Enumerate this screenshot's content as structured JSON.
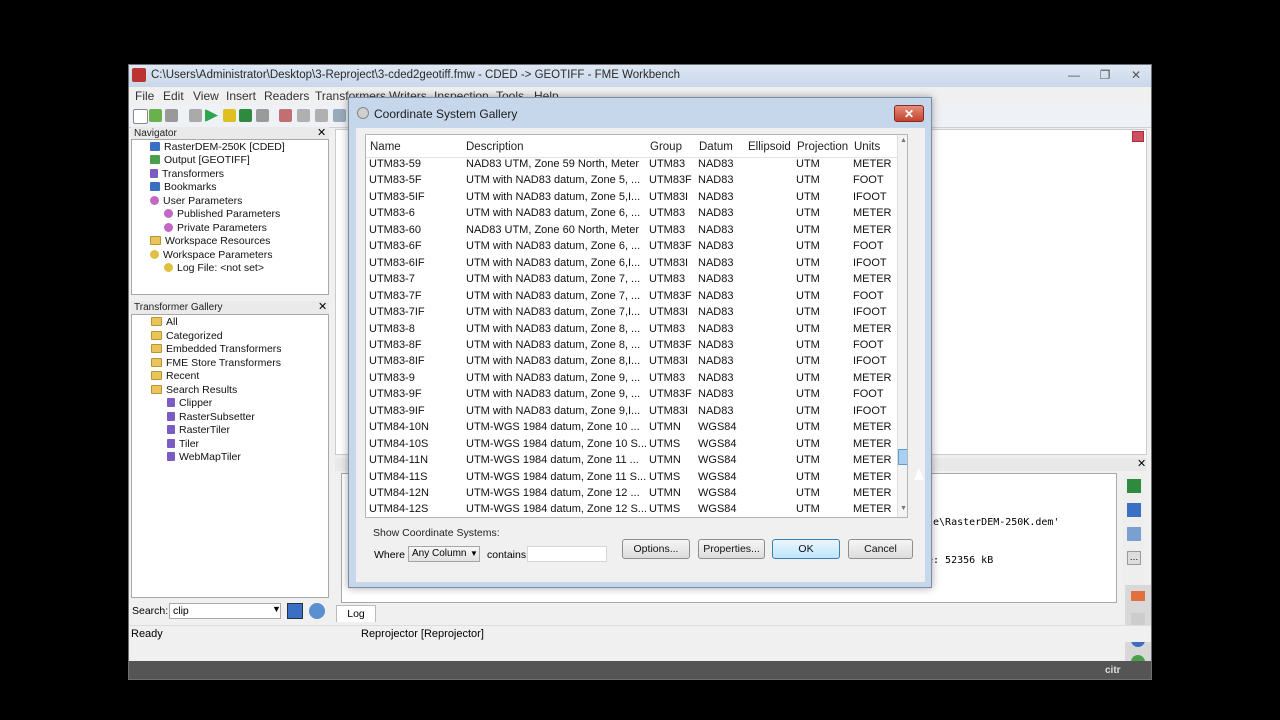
{
  "window": {
    "title": "C:\\Users\\Administrator\\Desktop\\3-Reproject\\3-cded2geotiff.fmw - CDED -> GEOTIFF - FME Workbench",
    "menu": [
      "File",
      "Edit",
      "View",
      "Insert",
      "Readers",
      "Transformers",
      "Writers",
      "Inspection",
      "Tools",
      "Help"
    ]
  },
  "navigator": {
    "title": "Navigator",
    "items": [
      {
        "label": "RasterDEM-250K [CDED]",
        "icon": "reader-icon"
      },
      {
        "label": "Output [GEOTIFF]",
        "icon": "writer-icon"
      },
      {
        "label": "Transformers",
        "icon": "transformer-icon"
      },
      {
        "label": "Bookmarks",
        "icon": "bookmark-icon"
      },
      {
        "label": "User Parameters",
        "icon": "gear-icon"
      },
      {
        "label": "Published Parameters",
        "icon": "gear-icon"
      },
      {
        "label": "Private Parameters",
        "icon": "gear-icon"
      },
      {
        "label": "Workspace Resources",
        "icon": "folder-icon"
      },
      {
        "label": "Workspace Parameters",
        "icon": "gear-icon"
      },
      {
        "label": "Log File: <not set>",
        "icon": "gear-icon"
      }
    ]
  },
  "transformer_gallery": {
    "title": "Transformer Gallery",
    "items": [
      {
        "label": "All",
        "icon": "folder-icon"
      },
      {
        "label": "Categorized",
        "icon": "folder-icon"
      },
      {
        "label": "Embedded Transformers",
        "icon": "folder-icon"
      },
      {
        "label": "FME Store Transformers",
        "icon": "folder-icon"
      },
      {
        "label": "Recent",
        "icon": "folder-icon"
      },
      {
        "label": "Search Results",
        "icon": "folder-icon"
      },
      {
        "label": "Clipper",
        "icon": "transformer-icon"
      },
      {
        "label": "RasterSubsetter",
        "icon": "transformer-icon"
      },
      {
        "label": "RasterTiler",
        "icon": "transformer-icon"
      },
      {
        "label": "Tiler",
        "icon": "transformer-icon"
      },
      {
        "label": "WebMapTiler",
        "icon": "transformer-icon"
      }
    ],
    "search_label": "Search:",
    "search_value": "clip"
  },
  "log": {
    "tab_label": "Log",
    "line1": "le\\RasterDEM-250K.dem'",
    "line2": "e: 52356 kB"
  },
  "statusbar": {
    "left": "Ready",
    "middle": "Reprojector [Reprojector]"
  },
  "dialog": {
    "title": "Coordinate System Gallery",
    "columns": [
      "Name",
      "Description",
      "Group",
      "Datum",
      "Ellipsoid",
      "Projection",
      "Units"
    ],
    "rows": [
      [
        "UTM83-59",
        "NAD83 UTM, Zone 59 North, Meter",
        "UTM83",
        "NAD83",
        "",
        "UTM",
        "METER"
      ],
      [
        "UTM83-5F",
        "UTM with NAD83 datum, Zone 5, ...",
        "UTM83F",
        "NAD83",
        "",
        "UTM",
        "FOOT"
      ],
      [
        "UTM83-5IF",
        "UTM with NAD83 datum, Zone 5,I...",
        "UTM83I",
        "NAD83",
        "",
        "UTM",
        "IFOOT"
      ],
      [
        "UTM83-6",
        "UTM with NAD83 datum, Zone 6, ...",
        "UTM83",
        "NAD83",
        "",
        "UTM",
        "METER"
      ],
      [
        "UTM83-60",
        "NAD83 UTM, Zone 60 North, Meter",
        "UTM83",
        "NAD83",
        "",
        "UTM",
        "METER"
      ],
      [
        "UTM83-6F",
        "UTM with NAD83 datum, Zone 6, ...",
        "UTM83F",
        "NAD83",
        "",
        "UTM",
        "FOOT"
      ],
      [
        "UTM83-6IF",
        "UTM with NAD83 datum, Zone 6,I...",
        "UTM83I",
        "NAD83",
        "",
        "UTM",
        "IFOOT"
      ],
      [
        "UTM83-7",
        "UTM with NAD83 datum, Zone 7, ...",
        "UTM83",
        "NAD83",
        "",
        "UTM",
        "METER"
      ],
      [
        "UTM83-7F",
        "UTM with NAD83 datum, Zone 7, ...",
        "UTM83F",
        "NAD83",
        "",
        "UTM",
        "FOOT"
      ],
      [
        "UTM83-7IF",
        "UTM with NAD83 datum, Zone 7,I...",
        "UTM83I",
        "NAD83",
        "",
        "UTM",
        "IFOOT"
      ],
      [
        "UTM83-8",
        "UTM with NAD83 datum, Zone 8, ...",
        "UTM83",
        "NAD83",
        "",
        "UTM",
        "METER"
      ],
      [
        "UTM83-8F",
        "UTM with NAD83 datum, Zone 8, ...",
        "UTM83F",
        "NAD83",
        "",
        "UTM",
        "FOOT"
      ],
      [
        "UTM83-8IF",
        "UTM with NAD83 datum, Zone 8,I...",
        "UTM83I",
        "NAD83",
        "",
        "UTM",
        "IFOOT"
      ],
      [
        "UTM83-9",
        "UTM with NAD83 datum, Zone 9, ...",
        "UTM83",
        "NAD83",
        "",
        "UTM",
        "METER"
      ],
      [
        "UTM83-9F",
        "UTM with NAD83 datum, Zone 9, ...",
        "UTM83F",
        "NAD83",
        "",
        "UTM",
        "FOOT"
      ],
      [
        "UTM83-9IF",
        "UTM with NAD83 datum, Zone 9,I...",
        "UTM83I",
        "NAD83",
        "",
        "UTM",
        "IFOOT"
      ],
      [
        "UTM84-10N",
        "UTM-WGS 1984 datum, Zone 10 ...",
        "UTMN",
        "WGS84",
        "",
        "UTM",
        "METER"
      ],
      [
        "UTM84-10S",
        "UTM-WGS 1984 datum, Zone 10 S...",
        "UTMS",
        "WGS84",
        "",
        "UTM",
        "METER"
      ],
      [
        "UTM84-11N",
        "UTM-WGS 1984 datum, Zone 11 ...",
        "UTMN",
        "WGS84",
        "",
        "UTM",
        "METER"
      ],
      [
        "UTM84-11S",
        "UTM-WGS 1984 datum, Zone 11 S...",
        "UTMS",
        "WGS84",
        "",
        "UTM",
        "METER"
      ],
      [
        "UTM84-12N",
        "UTM-WGS 1984 datum, Zone 12 ...",
        "UTMN",
        "WGS84",
        "",
        "UTM",
        "METER"
      ],
      [
        "UTM84-12S",
        "UTM-WGS 1984 datum, Zone 12 S...",
        "UTMS",
        "WGS84",
        "",
        "UTM",
        "METER"
      ]
    ],
    "show_label": "Show Coordinate Systems:",
    "where_label": "Where",
    "where_value": "Any Column",
    "contains_label": "contains",
    "contains_value": "",
    "buttons": {
      "options": "Options...",
      "properties": "Properties...",
      "ok": "OK",
      "cancel": "Cancel"
    }
  },
  "watermark": "citr"
}
